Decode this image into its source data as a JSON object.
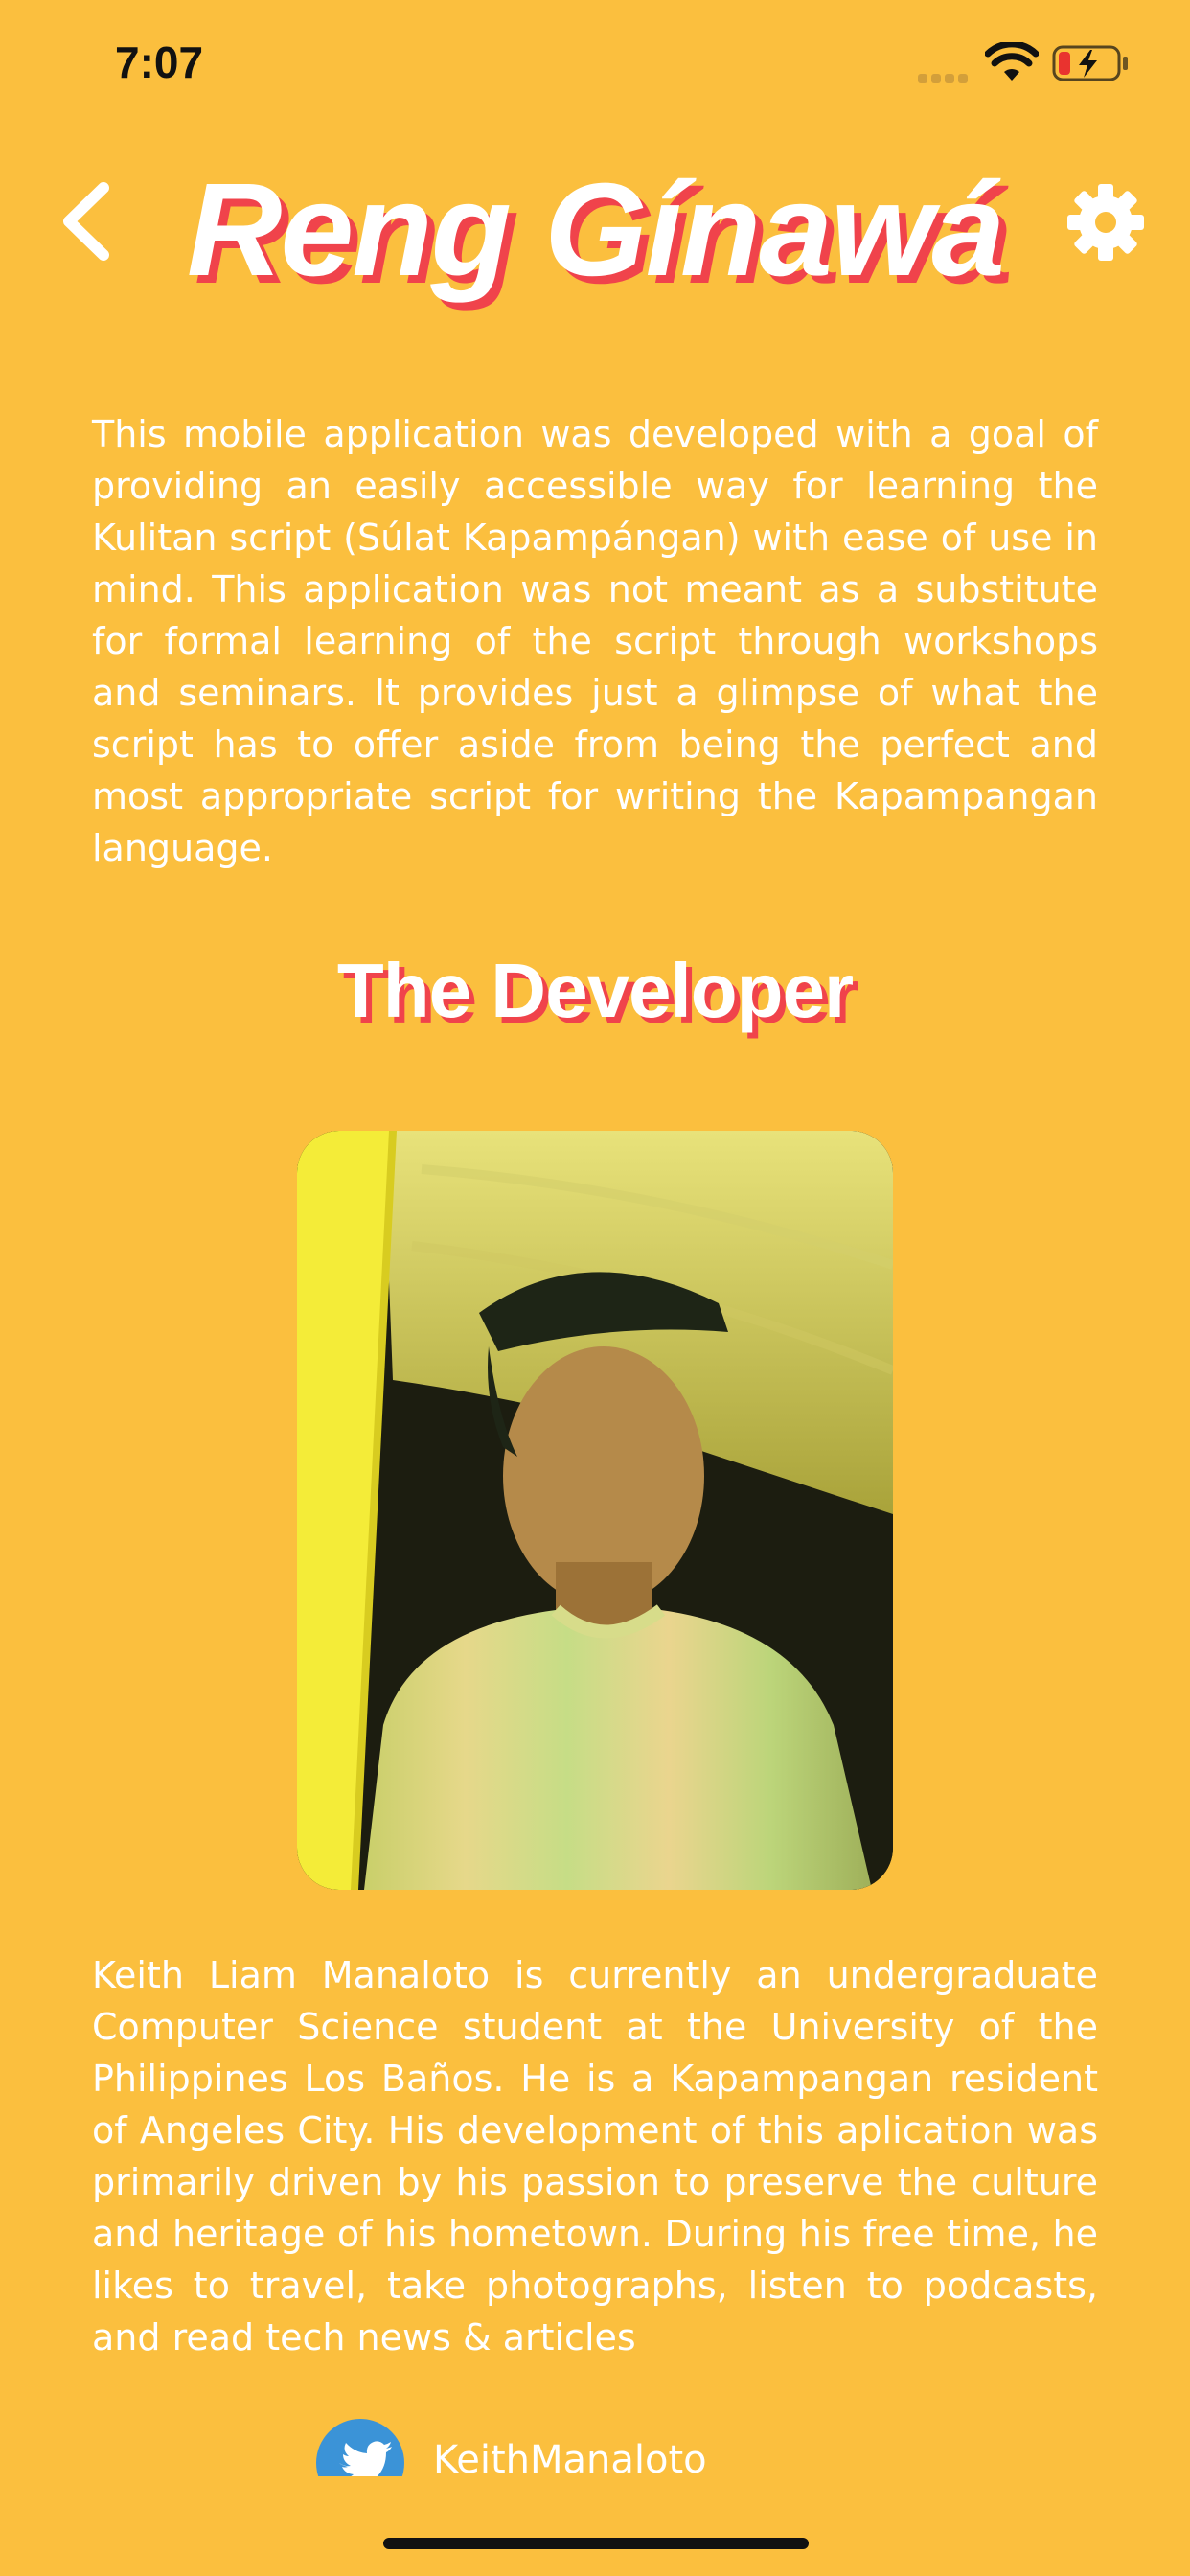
{
  "status_bar": {
    "time": "7:07"
  },
  "header": {
    "title": "Reng Gínawá",
    "back_icon": "chevron-left-icon",
    "settings_icon": "gear-icon"
  },
  "intro": {
    "text": "This mobile application was developed with a goal of providing an easily accessible way for learning the Kulitan script (Súlat Kapampángan) with ease of use in mind. This application was not meant as a substitute for formal learning of the script through workshops and seminars. It provides just a glimpse of what the script has to offer aside from being the perfect and most appropriate script for writing the Kapampangan language."
  },
  "developer": {
    "heading": "The Developer",
    "bio": "Keith Liam Manaloto is currently an undergraduate Computer Science student at the University of the Philippines Los Baños. He is a Kapampangan resident of Angeles City. His development of this aplication was primarily driven by his passion to preserve the culture and heritage of his hometown. During his free time, he likes to travel, take photographs, listen to podcasts, and read tech news & articles"
  },
  "social": {
    "twitter_handle": "KeithManaloto",
    "icon": "twitter-icon"
  },
  "colors": {
    "background": "#FBBF3E",
    "title_shadow": "#F0434B",
    "twitter_blue": "#3B93D7"
  }
}
